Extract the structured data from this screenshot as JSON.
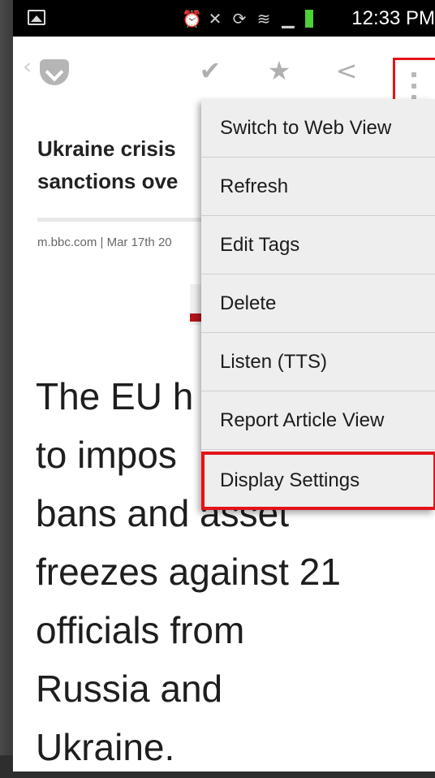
{
  "status_bar": {
    "time": "12:33 PM",
    "icons": [
      "image-notification-icon",
      "alarm-icon",
      "mute-icon",
      "sync-icon",
      "wifi-icon",
      "signal-icon",
      "battery-icon"
    ],
    "battery_color": "#4cd137"
  },
  "toolbar": {
    "back_glyph": "‹",
    "check_glyph": "✔",
    "star_glyph": "★",
    "share_glyph": "<"
  },
  "article": {
    "title": "Ukraine crisis\nsanctions ove",
    "meta": "m.bbc.com | Mar 17th 20",
    "body_lines": [
      "The EU h",
      "to impos",
      "bans and asset",
      "freezes against 21",
      "officials from",
      "Russia and",
      "Ukraine."
    ]
  },
  "menu": {
    "items": [
      "Switch to Web View",
      "Refresh",
      "Edit Tags",
      "Delete",
      "Listen (TTS)",
      "Report Article View",
      "Display Settings"
    ]
  },
  "colors": {
    "highlight": "#e3131b",
    "menu_bg": "#eeeeee",
    "status_bg": "#000000"
  }
}
